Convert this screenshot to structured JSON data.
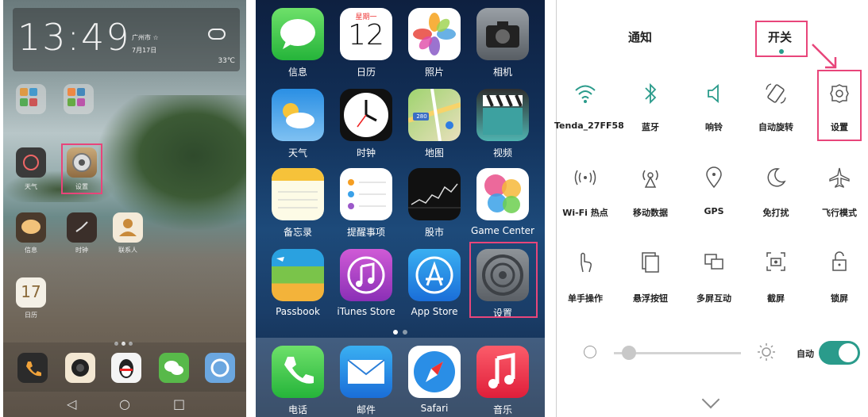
{
  "android": {
    "clock": {
      "time": "13:49",
      "city": "广州市 ☆",
      "date": "7月17日",
      "temperature": "33℃"
    },
    "apps": [
      {
        "name": "folder-1",
        "label": ""
      },
      {
        "name": "folder-2",
        "label": ""
      },
      {
        "name": "weather",
        "label": "天气"
      },
      {
        "name": "settings",
        "label": "设置"
      },
      {
        "name": "messages",
        "label": "信息"
      },
      {
        "name": "clock",
        "label": "时钟"
      },
      {
        "name": "contacts",
        "label": "联系人"
      },
      {
        "name": "calendar",
        "label": "日历",
        "day": "17"
      }
    ],
    "dock": [
      "phone",
      "camera",
      "qq",
      "wechat",
      "browser"
    ],
    "navbar": {
      "back": "◁",
      "home": "○",
      "recent": "□"
    }
  },
  "ios": {
    "apps": [
      {
        "name": "messages",
        "label": "信息"
      },
      {
        "name": "calendar",
        "label": "日历",
        "weekday": "星期一",
        "day": "12"
      },
      {
        "name": "photos",
        "label": "照片"
      },
      {
        "name": "camera",
        "label": "相机"
      },
      {
        "name": "weather",
        "label": "天气"
      },
      {
        "name": "clock",
        "label": "时钟"
      },
      {
        "name": "maps",
        "label": "地图",
        "badge": "280"
      },
      {
        "name": "videos",
        "label": "视频"
      },
      {
        "name": "notes",
        "label": "备忘录"
      },
      {
        "name": "reminders",
        "label": "提醒事项"
      },
      {
        "name": "stocks",
        "label": "股市"
      },
      {
        "name": "game-center",
        "label": "Game Center"
      },
      {
        "name": "passbook",
        "label": "Passbook"
      },
      {
        "name": "itunes-store",
        "label": "iTunes Store"
      },
      {
        "name": "app-store",
        "label": "App Store"
      },
      {
        "name": "settings",
        "label": "设置"
      }
    ],
    "dock": [
      {
        "name": "phone",
        "label": "电话"
      },
      {
        "name": "mail",
        "label": "邮件"
      },
      {
        "name": "safari",
        "label": "Safari"
      },
      {
        "name": "music",
        "label": "音乐"
      }
    ]
  },
  "shade": {
    "tabs": {
      "notifications": "通知",
      "switches": "开关"
    },
    "tiles": [
      {
        "name": "wifi",
        "label": "Tenda_27FF58",
        "icon": "wifi-icon"
      },
      {
        "name": "bluetooth",
        "label": "蓝牙",
        "icon": "bluetooth-icon"
      },
      {
        "name": "ring",
        "label": "响铃",
        "icon": "speaker-icon"
      },
      {
        "name": "auto-rotate",
        "label": "自动旋转",
        "icon": "rotate-icon"
      },
      {
        "name": "settings",
        "label": "设置",
        "icon": "gear-icon"
      },
      {
        "name": "hotspot",
        "label": "Wi-Fi 热点",
        "icon": "hotspot-icon"
      },
      {
        "name": "mobile-data",
        "label": "移动数据",
        "icon": "antenna-icon"
      },
      {
        "name": "gps",
        "label": "GPS",
        "icon": "location-icon"
      },
      {
        "name": "do-not-disturb",
        "label": "免打扰",
        "icon": "moon-icon"
      },
      {
        "name": "airplane-mode",
        "label": "飞行模式",
        "icon": "airplane-icon"
      },
      {
        "name": "one-hand",
        "label": "单手操作",
        "icon": "hand-icon"
      },
      {
        "name": "floating-button",
        "label": "悬浮按钮",
        "icon": "float-icon"
      },
      {
        "name": "multi-screen",
        "label": "多屏互动",
        "icon": "multiscreen-icon"
      },
      {
        "name": "screenshot",
        "label": "截屏",
        "icon": "screenshot-icon"
      },
      {
        "name": "lock-screen",
        "label": "锁屏",
        "icon": "lock-icon"
      }
    ],
    "brightness": {
      "auto_label": "自动",
      "auto_on": true,
      "level": 0.08
    }
  },
  "colors": {
    "highlight": "#e8457a",
    "accent": "#2a9b8b"
  }
}
